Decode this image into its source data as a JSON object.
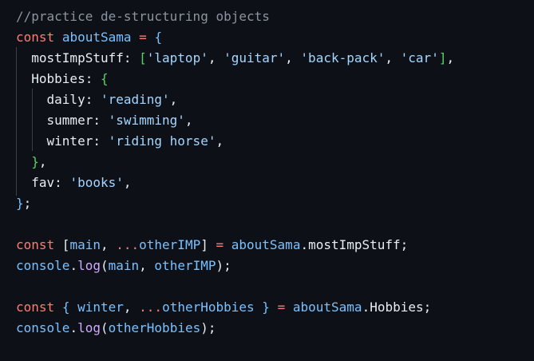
{
  "editor": {
    "background": "#0d1117",
    "lines": [
      [
        {
          "t": "//practice de-structuring objects",
          "c": "comment"
        }
      ],
      [
        {
          "t": "const",
          "c": "keyword"
        },
        {
          "t": " ",
          "c": "default"
        },
        {
          "t": "aboutSama",
          "c": "const"
        },
        {
          "t": " ",
          "c": "default"
        },
        {
          "t": "=",
          "c": "op"
        },
        {
          "t": " ",
          "c": "default"
        },
        {
          "t": "{",
          "c": "brace-outer"
        }
      ],
      [
        {
          "t": "  mostImpStuff: ",
          "c": "default"
        },
        {
          "t": "[",
          "c": "bracket"
        },
        {
          "t": "'laptop'",
          "c": "string"
        },
        {
          "t": ", ",
          "c": "default"
        },
        {
          "t": "'guitar'",
          "c": "string"
        },
        {
          "t": ", ",
          "c": "default"
        },
        {
          "t": "'back-pack'",
          "c": "string"
        },
        {
          "t": ", ",
          "c": "default"
        },
        {
          "t": "'car'",
          "c": "string"
        },
        {
          "t": "]",
          "c": "bracket"
        },
        {
          "t": ",",
          "c": "default"
        }
      ],
      [
        {
          "t": "  Hobbies: ",
          "c": "default"
        },
        {
          "t": "{",
          "c": "brace-inner"
        }
      ],
      [
        {
          "t": "    daily: ",
          "c": "default"
        },
        {
          "t": "'reading'",
          "c": "string"
        },
        {
          "t": ",",
          "c": "default"
        }
      ],
      [
        {
          "t": "    summer: ",
          "c": "default"
        },
        {
          "t": "'swimming'",
          "c": "string"
        },
        {
          "t": ",",
          "c": "default"
        }
      ],
      [
        {
          "t": "    winter: ",
          "c": "default"
        },
        {
          "t": "'riding horse'",
          "c": "string"
        },
        {
          "t": ",",
          "c": "default"
        }
      ],
      [
        {
          "t": "  ",
          "c": "default"
        },
        {
          "t": "}",
          "c": "brace-inner"
        },
        {
          "t": ",",
          "c": "default"
        }
      ],
      [
        {
          "t": "  fav: ",
          "c": "default"
        },
        {
          "t": "'books'",
          "c": "string"
        },
        {
          "t": ",",
          "c": "default"
        }
      ],
      [
        {
          "t": "}",
          "c": "brace-outer"
        },
        {
          "t": ";",
          "c": "default"
        }
      ],
      [],
      [
        {
          "t": "const",
          "c": "keyword"
        },
        {
          "t": " [",
          "c": "default"
        },
        {
          "t": "main",
          "c": "const"
        },
        {
          "t": ", ",
          "c": "default"
        },
        {
          "t": "...",
          "c": "op"
        },
        {
          "t": "otherIMP",
          "c": "const"
        },
        {
          "t": "] ",
          "c": "default"
        },
        {
          "t": "=",
          "c": "op"
        },
        {
          "t": " ",
          "c": "default"
        },
        {
          "t": "aboutSama",
          "c": "const"
        },
        {
          "t": ".mostImpStuff;",
          "c": "default"
        }
      ],
      [
        {
          "t": "console",
          "c": "const"
        },
        {
          "t": ".",
          "c": "default"
        },
        {
          "t": "log",
          "c": "fn"
        },
        {
          "t": "(",
          "c": "default"
        },
        {
          "t": "main",
          "c": "const"
        },
        {
          "t": ", ",
          "c": "default"
        },
        {
          "t": "otherIMP",
          "c": "const"
        },
        {
          "t": ");",
          "c": "default"
        }
      ],
      [],
      [
        {
          "t": "const",
          "c": "keyword"
        },
        {
          "t": " ",
          "c": "default"
        },
        {
          "t": "{",
          "c": "const"
        },
        {
          "t": " ",
          "c": "default"
        },
        {
          "t": "winter",
          "c": "const"
        },
        {
          "t": ", ",
          "c": "default"
        },
        {
          "t": "...",
          "c": "op"
        },
        {
          "t": "otherHobbies",
          "c": "const"
        },
        {
          "t": " ",
          "c": "default"
        },
        {
          "t": "}",
          "c": "const"
        },
        {
          "t": " ",
          "c": "default"
        },
        {
          "t": "=",
          "c": "op"
        },
        {
          "t": " ",
          "c": "default"
        },
        {
          "t": "aboutSama",
          "c": "const"
        },
        {
          "t": ".Hobbies;",
          "c": "default"
        }
      ],
      [
        {
          "t": "console",
          "c": "const"
        },
        {
          "t": ".",
          "c": "default"
        },
        {
          "t": "log",
          "c": "fn"
        },
        {
          "t": "(",
          "c": "default"
        },
        {
          "t": "otherHobbies",
          "c": "const"
        },
        {
          "t": ");",
          "c": "default"
        }
      ]
    ]
  }
}
